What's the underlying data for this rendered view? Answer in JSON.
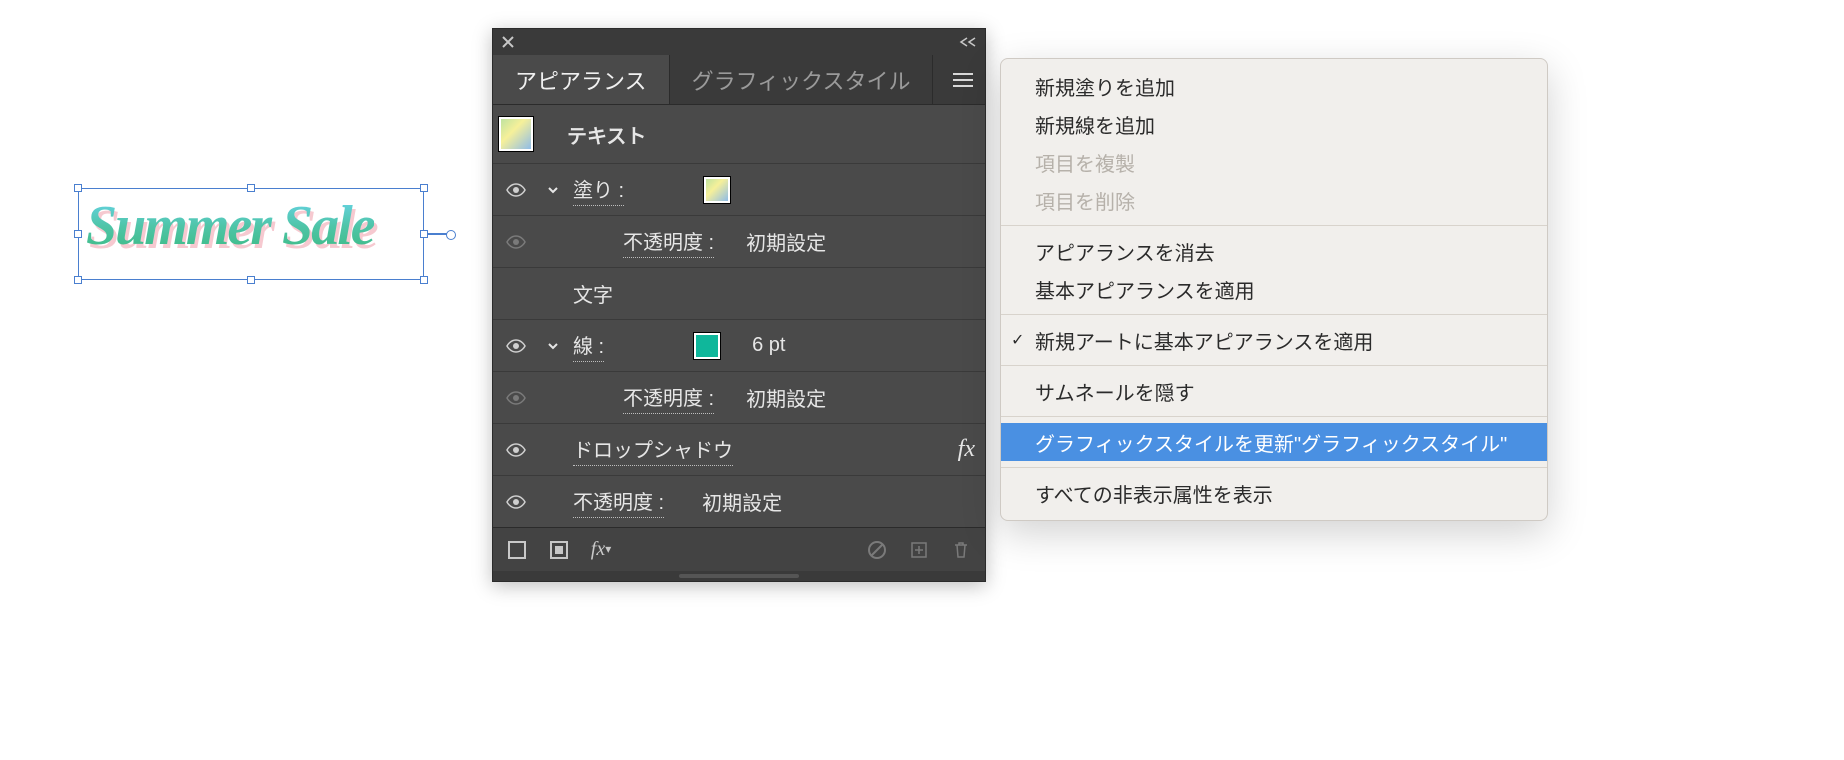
{
  "artwork": {
    "text": "Summer Sale"
  },
  "panel": {
    "tabs": {
      "appearance": "アピアランス",
      "graphic_styles": "グラフィックスタイル"
    },
    "header_label": "テキスト",
    "rows": {
      "fill_label": "塗り :",
      "opacity_label": "不透明度 :",
      "opacity_value": "初期設定",
      "characters": "文字",
      "stroke_label": "線 :",
      "stroke_weight": "6 pt",
      "dropshadow": "ドロップシャドウ",
      "fx": "fx"
    }
  },
  "menu": {
    "add_fill": "新規塗りを追加",
    "add_stroke": "新規線を追加",
    "duplicate": "項目を複製",
    "delete": "項目を削除",
    "clear": "アピアランスを消去",
    "reduce": "基本アピアランスを適用",
    "new_art_basic": "新規アートに基本アピアランスを適用",
    "hide_thumb": "サムネールを隠す",
    "redefine": "グラフィックスタイルを更新\"グラフィックスタイル\"",
    "show_hidden": "すべての非表示属性を表示"
  }
}
